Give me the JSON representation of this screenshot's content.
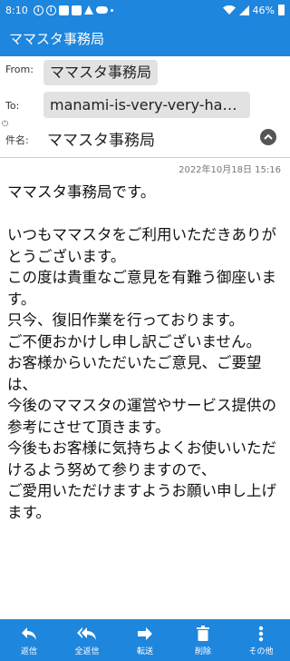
{
  "status_bar": {
    "time": "8:10",
    "battery": "46%"
  },
  "app_bar": {
    "title": "ママスタ事務局"
  },
  "header": {
    "from_label": "From:",
    "from_value": "ママスタ事務局",
    "to_label": "To:",
    "to_value": "manami-is-very-very-hap…",
    "subject_label": "件名:",
    "subject_value": "ママスタ事務局"
  },
  "date": "2022年10月18日 15:16",
  "body_paragraphs": [
    "ママスタ事務局です。",
    "",
    "いつもママスタをご利用いただきありがとうございます。",
    "この度は貴重なご意見を有難う御座います。",
    "只今、復旧作業を行っております。",
    "ご不便おかけし申し訳ございません。",
    "お客様からいただいたご意見、ご要望は、",
    "今後のママスタの運営やサービス提供の参考にさせて頂きます。",
    "今後もお客様に気持ちよくお使いいただけるよう努めて参りますので、",
    "ご愛用いただけますようお願い申し上げます。"
  ],
  "toolbar": {
    "reply": "返信",
    "reply_all": "全返信",
    "forward": "転送",
    "delete": "削除",
    "more": "その他"
  },
  "colors": {
    "primary": "#1f86de",
    "chip": "#e2e2e2"
  }
}
